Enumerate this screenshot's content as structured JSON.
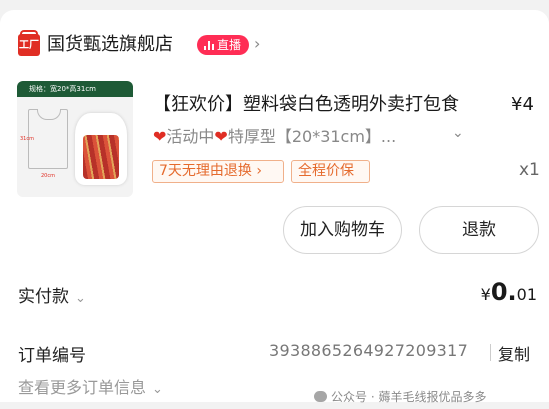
{
  "store": {
    "icon_text": "工厂",
    "name": "国货甄选旗舰店",
    "live_badge": "直播",
    "chevron": "›"
  },
  "product": {
    "image": {
      "banner_text": "规格：宽20*高31cm",
      "dim_height": "31cm",
      "dim_width": "20cm"
    },
    "title": "【狂欢价】塑料袋白色透明外卖打包食",
    "price": "¥4",
    "spec_heart": "❤",
    "spec_text_1": "活动中",
    "spec_text_2": "特厚型【20*31cm】...",
    "spec_chevron": "⌄",
    "tags": [
      "7天无理由退换 ›",
      "全程价保"
    ],
    "quantity": "x1"
  },
  "actions": {
    "add_to_cart": "加入购物车",
    "refund": "退款"
  },
  "payment": {
    "label": "实付款",
    "chevron": "⌄",
    "currency": "¥",
    "amount_int": "0.",
    "amount_dec": "01"
  },
  "order": {
    "label": "订单编号",
    "number": "3938865264927209317",
    "copy": "复制"
  },
  "more": {
    "label": "查看更多订单信息",
    "chevron": "⌄"
  },
  "watermark": {
    "text": "公众号 · 薅羊毛线报优品多多"
  },
  "colors": {
    "brand_red": "#e02e24",
    "live_pink": "#ff2d55",
    "tag_orange": "#e56a2d"
  }
}
